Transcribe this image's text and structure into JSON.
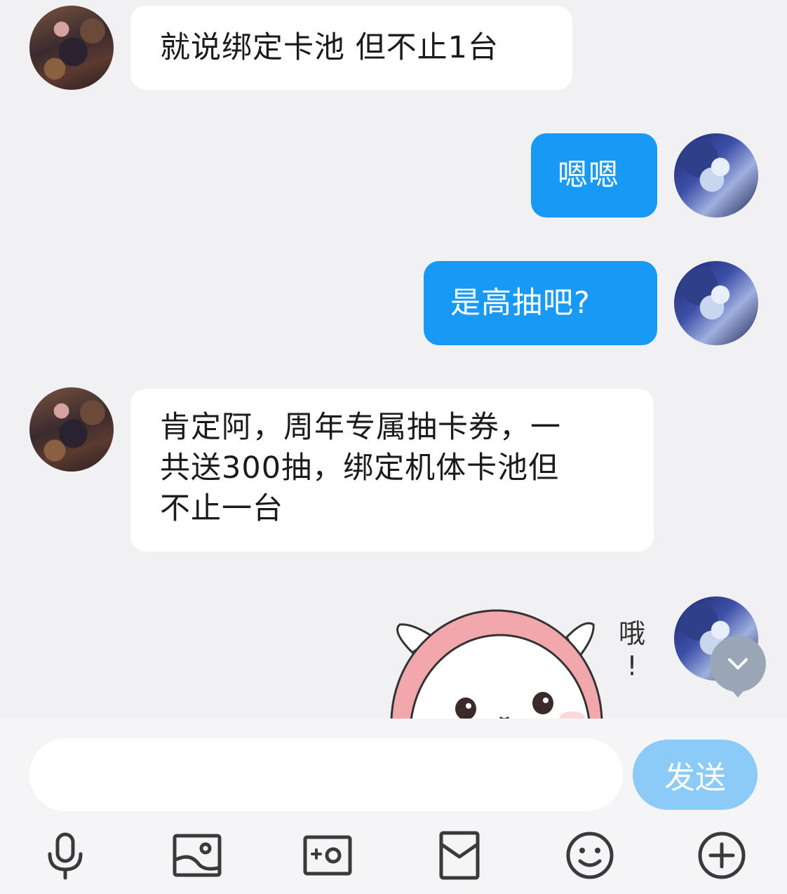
{
  "messages": [
    {
      "side": "other",
      "text": "就说绑定卡池 但不止1台"
    },
    {
      "side": "me",
      "text": "嗯嗯"
    },
    {
      "side": "me",
      "text": "是高抽吧?"
    },
    {
      "side": "other",
      "lines": [
        "肯定阿，周年专属抽卡券，一",
        "共送300抽，绑定机体卡池但",
        "不止一台"
      ]
    },
    {
      "side": "me",
      "type": "sticker",
      "sticker_text": [
        "哦",
        "!"
      ]
    }
  ],
  "input": {
    "value": "",
    "placeholder": ""
  },
  "send_label": "发送",
  "toolbar_icons": [
    "microphone-icon",
    "image-icon",
    "camera-icon",
    "red-packet-icon",
    "emoji-icon",
    "plus-icon"
  ],
  "colors": {
    "background": "#f1f1f3",
    "my_bubble": "#1899f6",
    "other_bubble": "#ffffff",
    "send_button": "#8ccaf7",
    "scroll_button": "#9aa6b6"
  }
}
